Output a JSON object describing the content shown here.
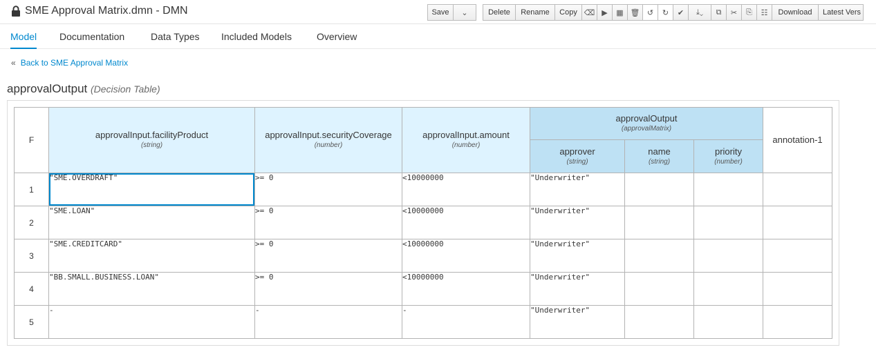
{
  "titlebar": {
    "title": "SME Approval Matrix.dmn - DMN",
    "lock_icon": "lock-icon"
  },
  "toolbar": {
    "save_label": "Save",
    "delete_label": "Delete",
    "rename_label": "Rename",
    "copy_label": "Copy",
    "download_label": "Download",
    "latest_version_label": "Latest Vers"
  },
  "tabs": [
    {
      "label": "Model",
      "active": true
    },
    {
      "label": "Documentation",
      "active": false
    },
    {
      "label": "Data Types",
      "active": false
    },
    {
      "label": "Included Models",
      "active": false
    },
    {
      "label": "Overview",
      "active": false
    }
  ],
  "back_link": "Back to SME Approval Matrix",
  "decision": {
    "name": "approvalOutput",
    "kind": "(Decision Table)"
  },
  "table": {
    "hit_policy": "F",
    "inputs": [
      {
        "name": "approvalInput.facilityProduct",
        "type": "(string)"
      },
      {
        "name": "approvalInput.securityCoverage",
        "type": "(number)"
      },
      {
        "name": "approvalInput.amount",
        "type": "(number)"
      }
    ],
    "output": {
      "name": "approvalOutput",
      "type": "(approvalMatrix)",
      "components": [
        {
          "name": "approver",
          "type": "(string)"
        },
        {
          "name": "name",
          "type": "(string)"
        },
        {
          "name": "priority",
          "type": "(number)"
        }
      ]
    },
    "annotation": "annotation-1",
    "rows": [
      {
        "num": "1",
        "cells": [
          "\"SME.OVERDRAFT\"",
          ">= 0",
          "<10000000",
          "\"Underwriter\"",
          "",
          "",
          ""
        ]
      },
      {
        "num": "2",
        "cells": [
          "\"SME.LOAN\"",
          ">= 0",
          "<10000000",
          "\"Underwriter\"",
          "",
          "",
          ""
        ]
      },
      {
        "num": "3",
        "cells": [
          "\"SME.CREDITCARD\"",
          ">= 0",
          "<10000000",
          "\"Underwriter\"",
          "",
          "",
          ""
        ]
      },
      {
        "num": "4",
        "cells": [
          "\"BB.SMALL.BUSINESS.LOAN\"",
          ">= 0",
          "<10000000",
          "\"Underwriter\"",
          "",
          "",
          ""
        ]
      },
      {
        "num": "5",
        "cells": [
          "-",
          "-",
          "-",
          "\"Underwriter\"",
          "",
          "",
          ""
        ]
      }
    ]
  },
  "colors": {
    "accent": "#0088ce",
    "input_header": "#def3ff",
    "output_header": "#bee1f4"
  }
}
